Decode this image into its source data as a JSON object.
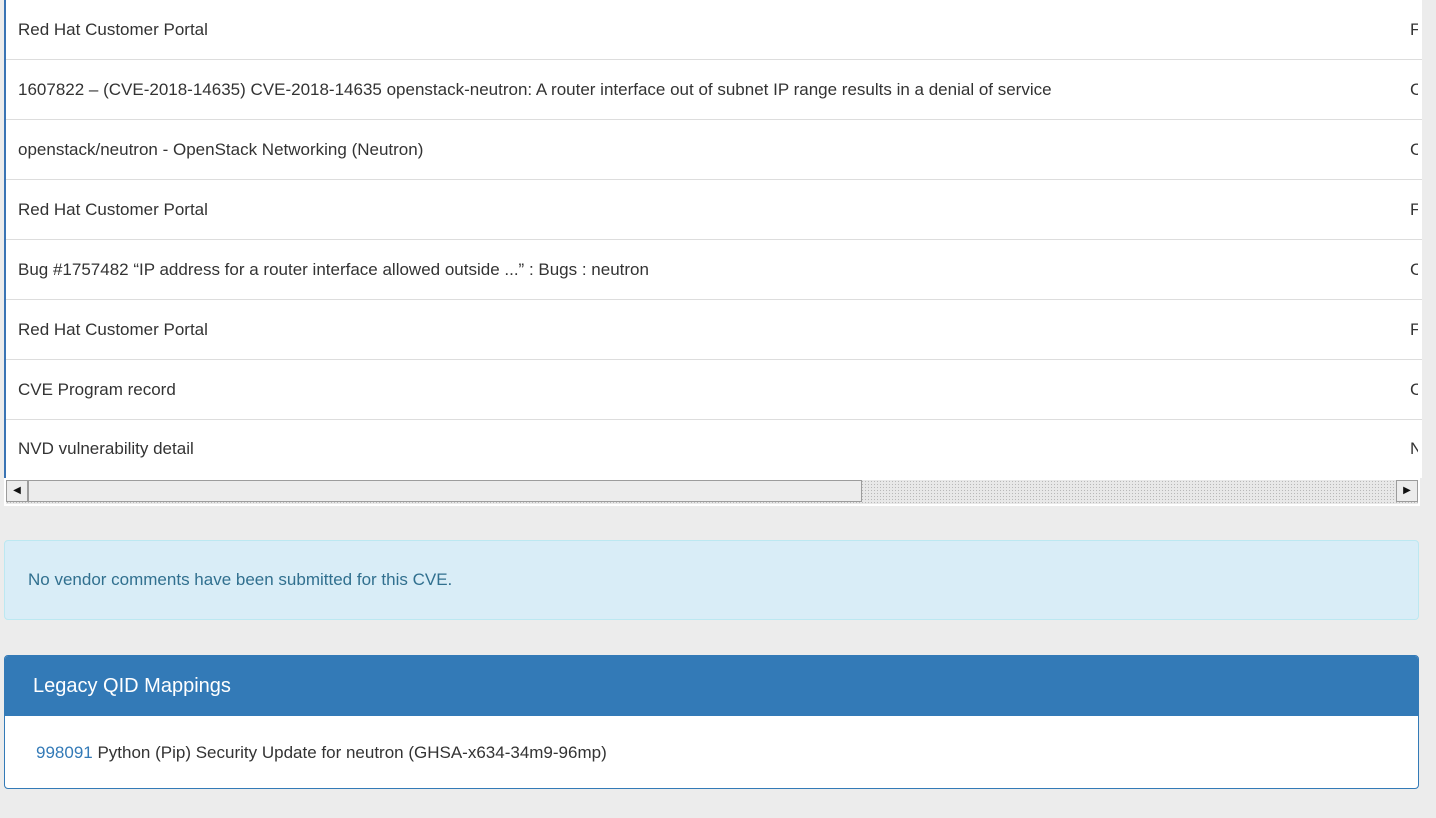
{
  "references": [
    {
      "title": "Red Hat Customer Portal",
      "source": "F"
    },
    {
      "title": "1607822 – (CVE-2018-14635) CVE-2018-14635 openstack-neutron: A router interface out of subnet IP range results in a denial of service",
      "source": "C"
    },
    {
      "title": "openstack/neutron - OpenStack Networking (Neutron)",
      "source": "C"
    },
    {
      "title": "Red Hat Customer Portal",
      "source": "F"
    },
    {
      "title": "Bug #1757482 “IP address for a router interface allowed outside ...” : Bugs : neutron",
      "source": "C"
    },
    {
      "title": "Red Hat Customer Portal",
      "source": "F"
    },
    {
      "title": "CVE Program record",
      "source": "C"
    },
    {
      "title": "NVD vulnerability detail",
      "source": "N"
    }
  ],
  "scrollbar": {
    "left_icon": "scroll-left-arrow-icon",
    "right_icon": "scroll-right-arrow-icon",
    "position": 0.0
  },
  "vendor_comments": {
    "message": "No vendor comments have been submitted for this CVE."
  },
  "legacy_qid": {
    "heading": "Legacy QID Mappings",
    "items": [
      {
        "qid": "998091",
        "description": " Python (Pip) Security Update for neutron (GHSA-x634-34m9-96mp)"
      }
    ]
  },
  "colors": {
    "primary": "#337ab7",
    "info_bg": "#d9edf7",
    "info_text": "#31708f",
    "page_bg": "#ececec"
  }
}
